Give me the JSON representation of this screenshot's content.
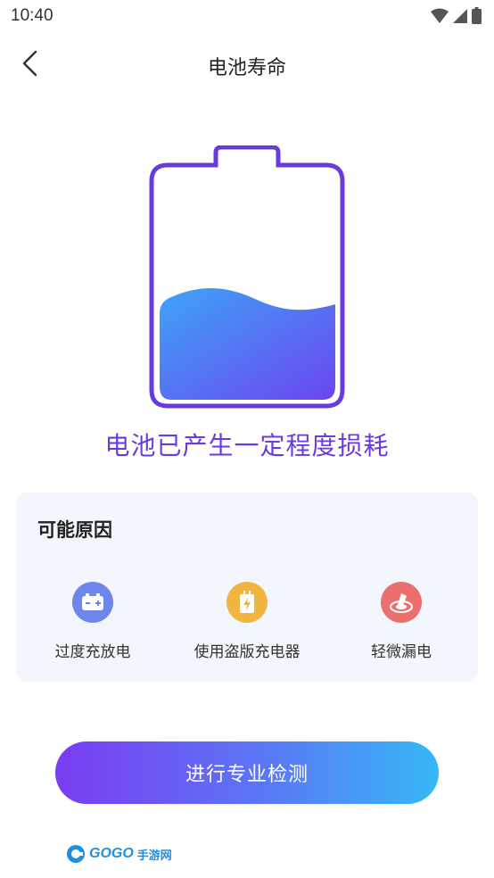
{
  "status_bar": {
    "time": "10:40"
  },
  "nav": {
    "title": "电池寿命"
  },
  "battery": {
    "fill_level": 0.42,
    "colors": {
      "outline": "#6a3bdc",
      "fill_start": "#3ea4f8",
      "fill_end": "#6c45f0"
    }
  },
  "headline": "电池已产生一定程度损耗",
  "reasons": {
    "title": "可能原因",
    "items": [
      {
        "label": "过度充放电",
        "icon": "battery-icon",
        "color": "#6f86ec"
      },
      {
        "label": "使用盗版充电器",
        "icon": "charger-icon",
        "color": "#f2b53f"
      },
      {
        "label": "轻微漏电",
        "icon": "leak-icon",
        "color": "#ec6f6f"
      }
    ]
  },
  "cta": {
    "label": "进行专业检测"
  },
  "watermark": {
    "brand": "GOGO",
    "brand_cn": "手游网"
  }
}
